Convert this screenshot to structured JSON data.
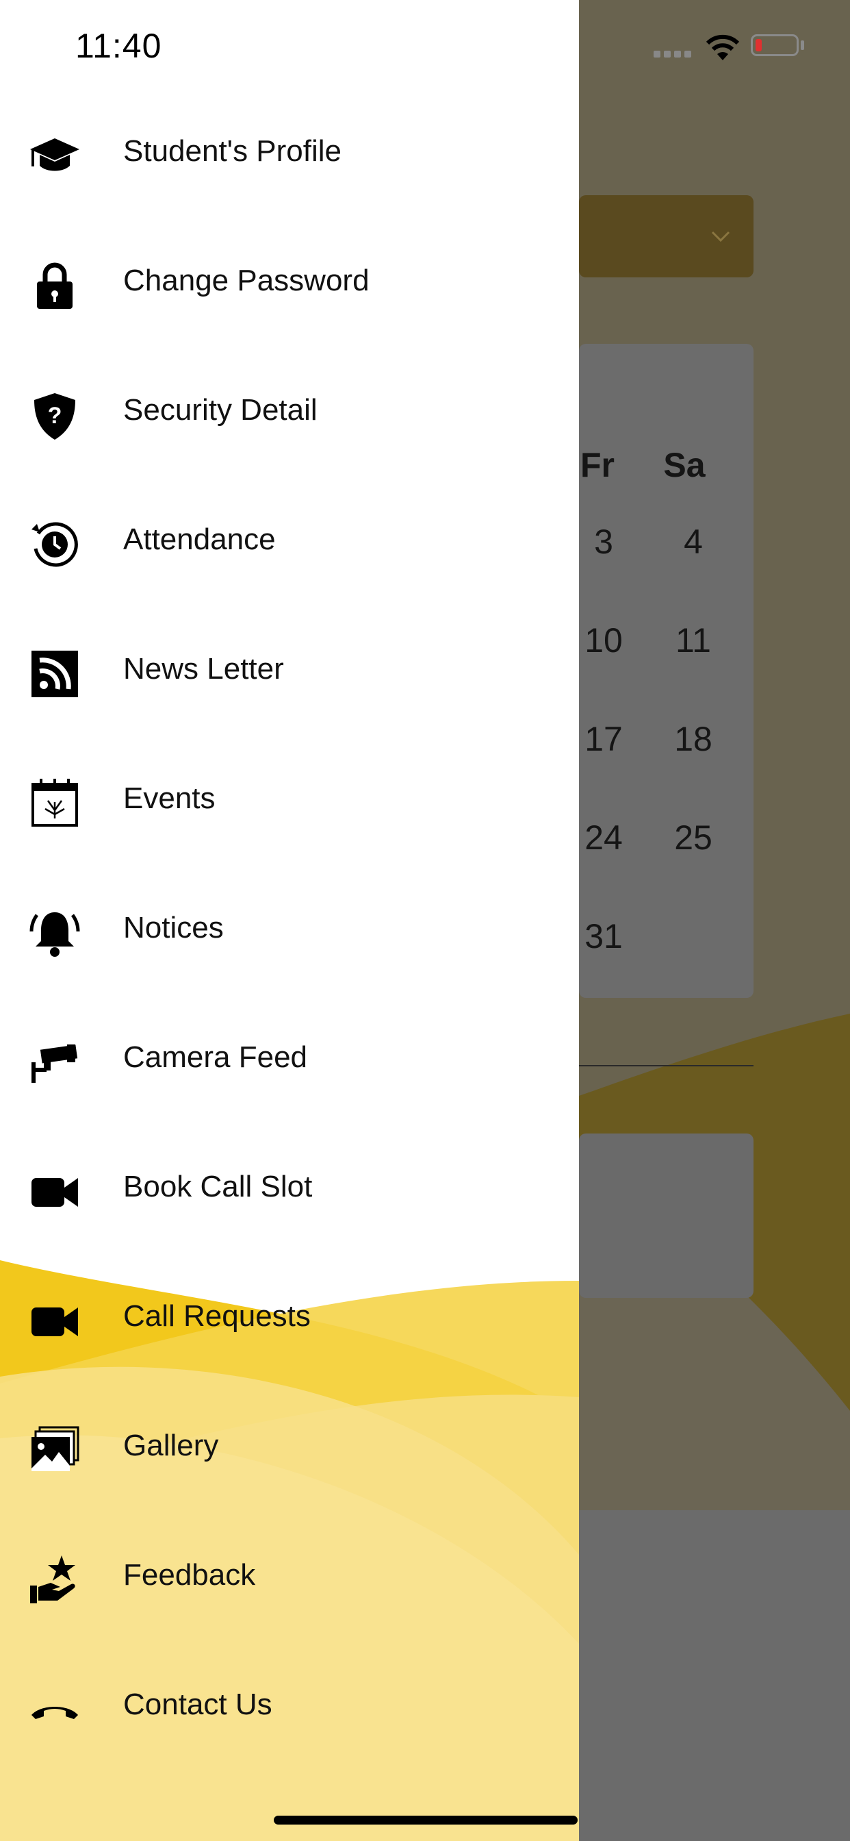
{
  "status_bar": {
    "time": "11:40"
  },
  "drawer": {
    "items": [
      {
        "label": "Student's Profile",
        "icon": "graduation-cap-icon"
      },
      {
        "label": "Change Password",
        "icon": "lock-icon"
      },
      {
        "label": "Security Detail",
        "icon": "shield-question-icon"
      },
      {
        "label": "Attendance",
        "icon": "clock-history-icon"
      },
      {
        "label": "News Letter",
        "icon": "rss-icon"
      },
      {
        "label": "Events",
        "icon": "calendar-fireworks-icon"
      },
      {
        "label": "Notices",
        "icon": "bell-icon"
      },
      {
        "label": "Camera Feed",
        "icon": "cctv-camera-icon"
      },
      {
        "label": "Book Call Slot",
        "icon": "video-camera-icon"
      },
      {
        "label": "Call Requests",
        "icon": "video-camera-icon"
      },
      {
        "label": "Gallery",
        "icon": "gallery-icon"
      },
      {
        "label": "Feedback",
        "icon": "hand-star-icon"
      },
      {
        "label": "Contact Us",
        "icon": "phone-icon"
      }
    ]
  },
  "background_calendar": {
    "weekdays": [
      "Fr",
      "Sa"
    ],
    "rows": [
      [
        "3",
        "4"
      ],
      [
        "10",
        "11"
      ],
      [
        "17",
        "18"
      ],
      [
        "24",
        "25"
      ],
      [
        "31",
        ""
      ]
    ]
  },
  "colors": {
    "accent": "#F2C81C",
    "wave_light": "#F7DE7A",
    "overlay": "#666666"
  }
}
